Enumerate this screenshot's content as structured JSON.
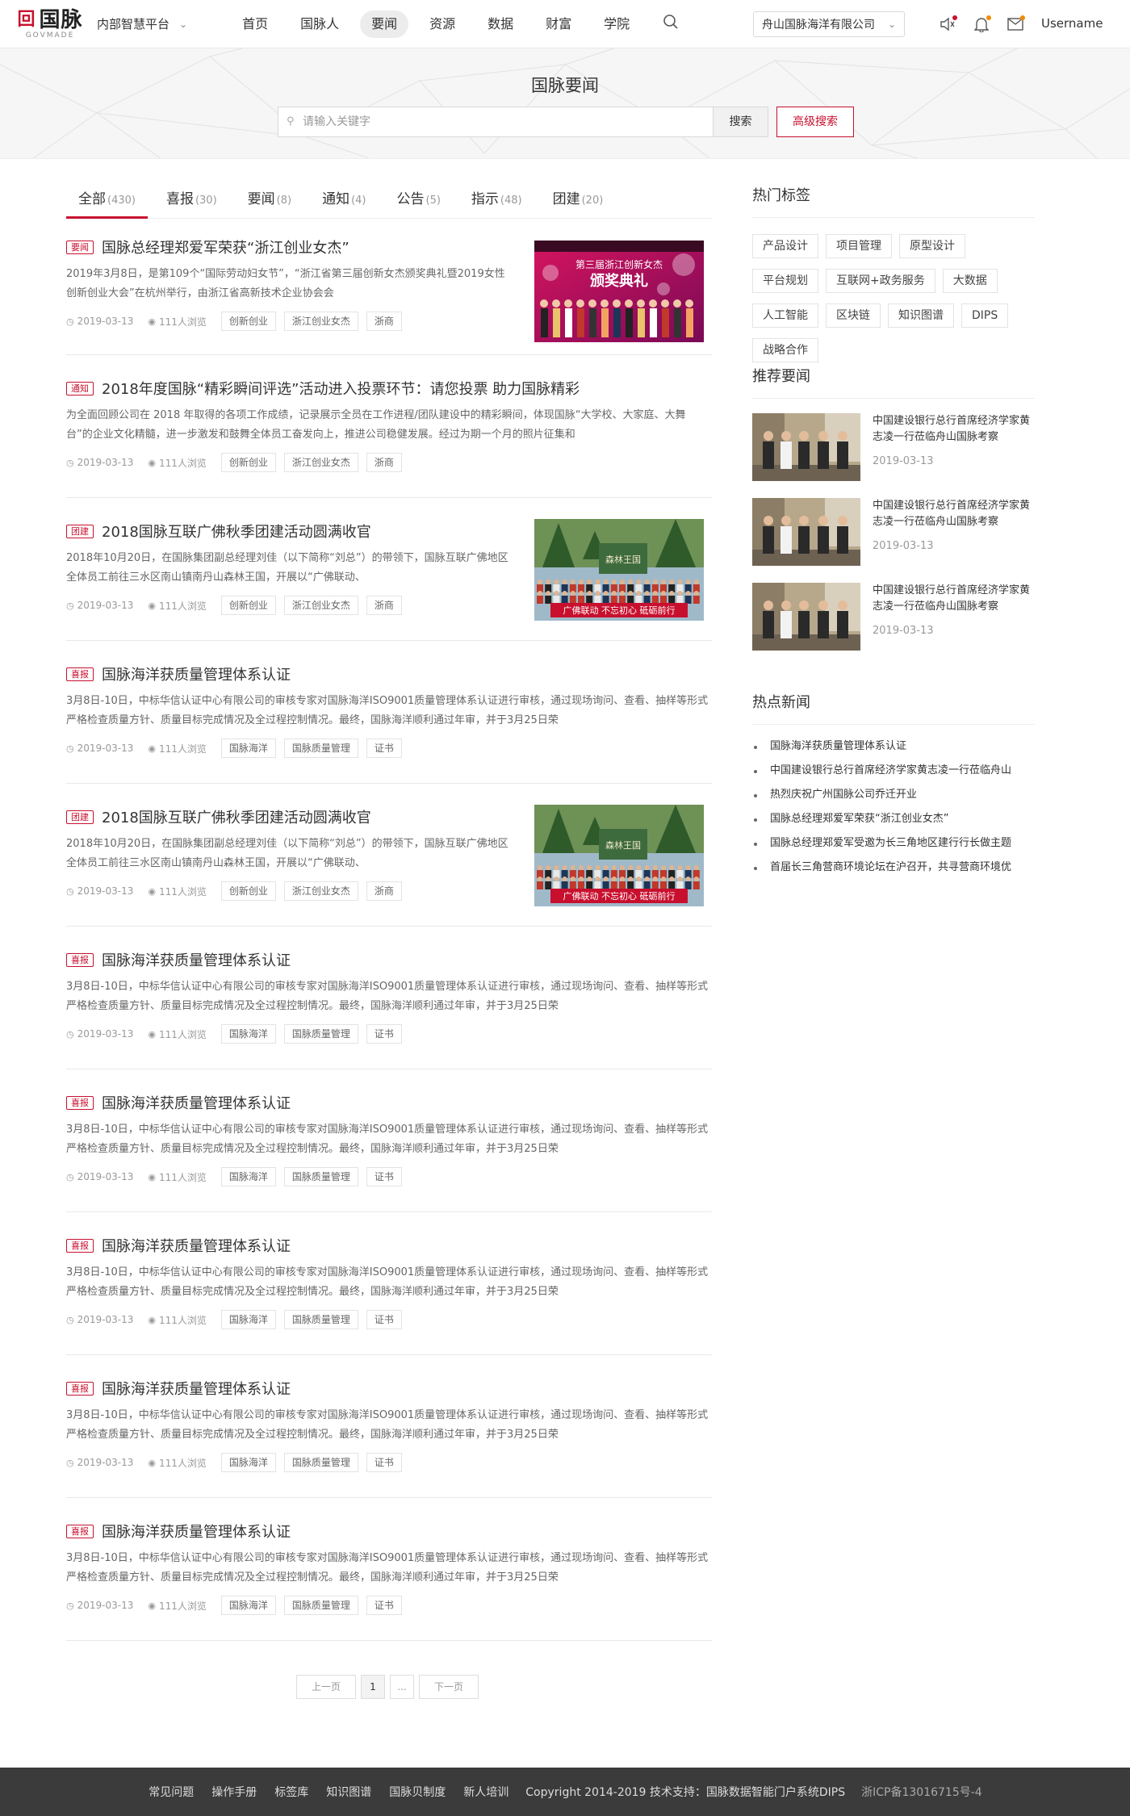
{
  "nav": {
    "logo_text": "国脉",
    "logo_sub": "GOVMADE",
    "platform": "内部智慧平台",
    "menu": [
      "首页",
      "国脉人",
      "要闻",
      "资源",
      "数据",
      "财富",
      "学院"
    ],
    "company": "舟山国脉海洋有限公司",
    "username": "Username"
  },
  "banner": {
    "title": "国脉要闻",
    "search_placeholder": "请输入关键字",
    "search_btn": "搜索",
    "advanced_btn": "高级搜索"
  },
  "tabs": [
    {
      "label": "全部",
      "count": "(430)"
    },
    {
      "label": "喜报",
      "count": "(30)"
    },
    {
      "label": "要闻",
      "count": "(8)"
    },
    {
      "label": "通知",
      "count": "(4)"
    },
    {
      "label": "公告",
      "count": "(5)"
    },
    {
      "label": "指示",
      "count": "(48)"
    },
    {
      "label": "团建",
      "count": "(20)"
    }
  ],
  "articles": [
    {
      "tag": "要闻",
      "title": "国脉总经理郑爱军荣获“浙江创业女杰”",
      "desc": "2019年3月8日，是第109个“国际劳动妇女节”，“浙江省第三届创新女杰颁奖典礼暨2019女性创新创业大会”在杭州举行，由浙江省高新技术企业协会会",
      "date": "2019-03-13",
      "views": "111人浏览",
      "keywords": [
        "创新创业",
        "浙江创业女杰",
        "浙商"
      ],
      "thumb": "stage",
      "thumb_caption": "第三届浙江创新女杰 颁奖典礼"
    },
    {
      "tag": "通知",
      "title": "2018年度国脉“精彩瞬间评选”活动进入投票环节：请您投票 助力国脉精彩",
      "desc": "为全面回顾公司在 2018 年取得的各项工作成绩，记录展示全员在工作进程/团队建设中的精彩瞬间，体现国脉“大学校、大家庭、大舞台”的企业文化精髓，进一步激发和鼓舞全体员工奋发向上，推进公司稳健发展。经过为期一个月的照片征集和",
      "date": "2019-03-13",
      "views": "111人浏览",
      "keywords": [
        "创新创业",
        "浙江创业女杰",
        "浙商"
      ],
      "thumb": ""
    },
    {
      "tag": "团建",
      "title": "2018国脉互联广佛秋季团建活动圆满收官",
      "desc": "2018年10月20日，在国脉集团副总经理刘佳（以下简称“刘总”）的带领下，国脉互联广佛地区全体员工前往三水区南山镇南丹山森林王国，开展以“广佛联动、",
      "date": "2019-03-13",
      "views": "111人浏览",
      "keywords": [
        "创新创业",
        "浙江创业女杰",
        "浙商"
      ],
      "thumb": "group",
      "thumb_caption": "广佛联动 不忘初心 砥砺前行"
    },
    {
      "tag": "喜报",
      "title": "国脉海洋获质量管理体系认证",
      "desc": "3月8日-10日，中标华信认证中心有限公司的审核专家对国脉海洋ISO9001质量管理体系认证进行审核，通过现场询问、查看、抽样等形式严格检查质量方针、质量目标完成情况及全过程控制情况。最终，国脉海洋顺利通过年审，并于3月25日荣",
      "date": "2019-03-13",
      "views": "111人浏览",
      "keywords": [
        "国脉海洋",
        "国脉质量管理",
        "证书"
      ],
      "thumb": ""
    },
    {
      "tag": "团建",
      "title": "2018国脉互联广佛秋季团建活动圆满收官",
      "desc": "2018年10月20日，在国脉集团副总经理刘佳（以下简称“刘总”）的带领下，国脉互联广佛地区全体员工前往三水区南山镇南丹山森林王国，开展以“广佛联动、",
      "date": "2019-03-13",
      "views": "111人浏览",
      "keywords": [
        "创新创业",
        "浙江创业女杰",
        "浙商"
      ],
      "thumb": "group",
      "thumb_caption": "广佛联动 不忘初心 砥砺前行"
    },
    {
      "tag": "喜报",
      "title": "国脉海洋获质量管理体系认证",
      "desc": "3月8日-10日，中标华信认证中心有限公司的审核专家对国脉海洋ISO9001质量管理体系认证进行审核，通过现场询问、查看、抽样等形式严格检查质量方针、质量目标完成情况及全过程控制情况。最终，国脉海洋顺利通过年审，并于3月25日荣",
      "date": "2019-03-13",
      "views": "111人浏览",
      "keywords": [
        "国脉海洋",
        "国脉质量管理",
        "证书"
      ],
      "thumb": ""
    },
    {
      "tag": "喜报",
      "title": "国脉海洋获质量管理体系认证",
      "desc": "3月8日-10日，中标华信认证中心有限公司的审核专家对国脉海洋ISO9001质量管理体系认证进行审核，通过现场询问、查看、抽样等形式严格检查质量方针、质量目标完成情况及全过程控制情况。最终，国脉海洋顺利通过年审，并于3月25日荣",
      "date": "2019-03-13",
      "views": "111人浏览",
      "keywords": [
        "国脉海洋",
        "国脉质量管理",
        "证书"
      ],
      "thumb": ""
    },
    {
      "tag": "喜报",
      "title": "国脉海洋获质量管理体系认证",
      "desc": "3月8日-10日，中标华信认证中心有限公司的审核专家对国脉海洋ISO9001质量管理体系认证进行审核，通过现场询问、查看、抽样等形式严格检查质量方针、质量目标完成情况及全过程控制情况。最终，国脉海洋顺利通过年审，并于3月25日荣",
      "date": "2019-03-13",
      "views": "111人浏览",
      "keywords": [
        "国脉海洋",
        "国脉质量管理",
        "证书"
      ],
      "thumb": ""
    },
    {
      "tag": "喜报",
      "title": "国脉海洋获质量管理体系认证",
      "desc": "3月8日-10日，中标华信认证中心有限公司的审核专家对国脉海洋ISO9001质量管理体系认证进行审核，通过现场询问、查看、抽样等形式严格检查质量方针、质量目标完成情况及全过程控制情况。最终，国脉海洋顺利通过年审，并于3月25日荣",
      "date": "2019-03-13",
      "views": "111人浏览",
      "keywords": [
        "国脉海洋",
        "国脉质量管理",
        "证书"
      ],
      "thumb": ""
    },
    {
      "tag": "喜报",
      "title": "国脉海洋获质量管理体系认证",
      "desc": "3月8日-10日，中标华信认证中心有限公司的审核专家对国脉海洋ISO9001质量管理体系认证进行审核，通过现场询问、查看、抽样等形式严格检查质量方针、质量目标完成情况及全过程控制情况。最终，国脉海洋顺利通过年审，并于3月25日荣",
      "date": "2019-03-13",
      "views": "111人浏览",
      "keywords": [
        "国脉海洋",
        "国脉质量管理",
        "证书"
      ],
      "thumb": ""
    }
  ],
  "pager": {
    "prev": "上一页",
    "current": "1",
    "ellipsis": "...",
    "next": "下一页"
  },
  "sidebar": {
    "hot_tags_title": "热门标签",
    "hot_tags": [
      "产品设计",
      "项目管理",
      "原型设计",
      "平台规划",
      "互联网+政务服务",
      "大数据",
      "人工智能",
      "区块链",
      "知识图谱",
      "DIPS",
      "战略合作"
    ],
    "recommend_title": "推荐要闻",
    "recommend": [
      {
        "title": "中国建设银行总行首席经济学家黄志凌一行莅临舟山国脉考察",
        "date": "2019-03-13"
      },
      {
        "title": "中国建设银行总行首席经济学家黄志凌一行莅临舟山国脉考察",
        "date": "2019-03-13"
      },
      {
        "title": "中国建设银行总行首席经济学家黄志凌一行莅临舟山国脉考察",
        "date": "2019-03-13"
      }
    ],
    "hot_news_title": "热点新闻",
    "hot_news": [
      "国脉海洋获质量管理体系认证",
      "中国建设银行总行首席经济学家黄志凌一行莅临舟山",
      "热烈庆祝广州国脉公司乔迁开业",
      "国脉总经理郑爱军荣获“浙江创业女杰”",
      "国脉总经理郑爱军受邀为长三角地区建行行长做主题",
      "首届长三角营商环境论坛在沪召开，共寻营商环境优"
    ]
  },
  "footer": {
    "links": [
      "常见问题",
      "操作手册",
      "标签库",
      "知识图谱",
      "国脉贝制度",
      "新人培训"
    ],
    "copyright": "Copyright 2014-2019 技术支持：国脉数据智能门户系统DIPS",
    "icp": "浙ICP备13016715号-4"
  },
  "colors": {
    "brand": "#c8102e",
    "notify_dot_1": "#c8102e",
    "notify_dot_2": "#f08c00",
    "footer_bg": "#3b3b3b"
  }
}
